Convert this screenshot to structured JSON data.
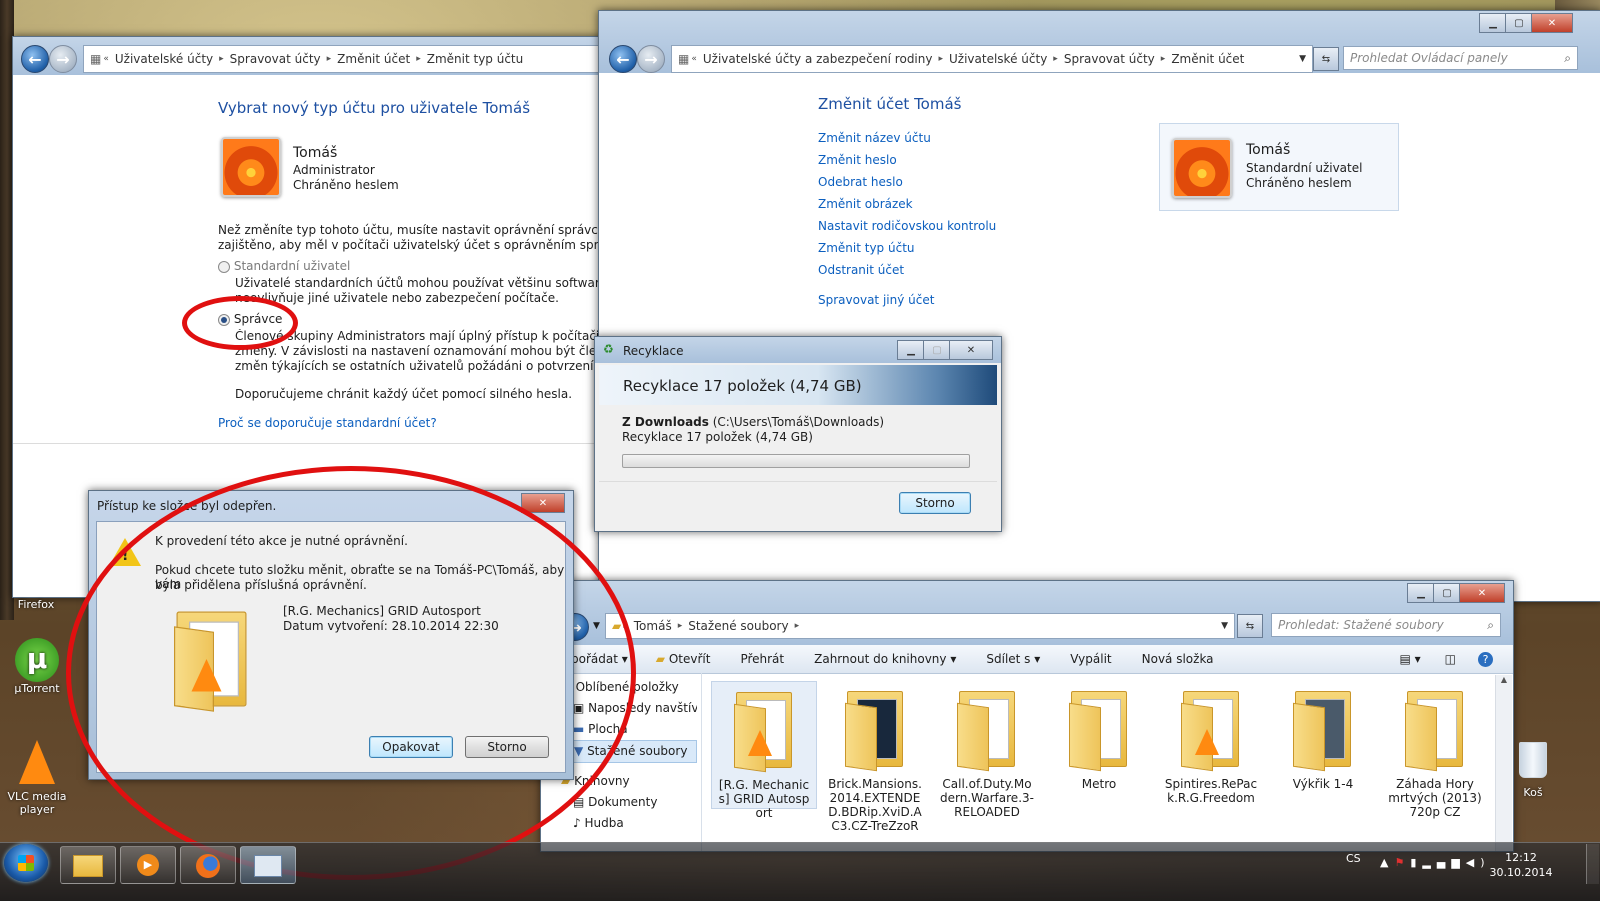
{
  "win_account_type": {
    "breadcrumb": [
      "Uživatelské účty",
      "Spravovat účty",
      "Změnit účet",
      "Změnit typ účtu"
    ],
    "heading": "Vybrat nový typ účtu pro uživatele Tomáš",
    "user_name": "Tomáš",
    "user_role": "Administrator",
    "user_status": "Chráněno heslem",
    "intro_1": "Než změníte typ tohoto účtu, musíte nastavit oprávnění správce jinému u",
    "intro_2": "zajištěno, aby měl v počítači uživatelský účet s oprávněním správce vždy n",
    "standard_label": "Standardní uživatel",
    "standard_desc_1": "Uživatelé standardních účtů mohou používat většinu softwaru a měnit",
    "standard_desc_2": "neovlivňuje jiné uživatele nebo zabezpečení počítače.",
    "admin_label": "Správce",
    "admin_desc_1": "Členové skupiny Administrators mají úplný přístup k počítači a moho",
    "admin_desc_2": "změny. V závislosti na nastavení oznamování mohou být členové skup",
    "admin_desc_3": "změn týkajících se ostatních uživatelů požádáni o potvrzení nebo zada",
    "recommend": "Doporučujeme chránit každý účet pomocí silného hesla.",
    "why_link": "Proč se doporučuje standardní účet?"
  },
  "win_change_account": {
    "breadcrumb": [
      "Uživatelské účty a zabezpečení rodiny",
      "Uživatelské účty",
      "Spravovat účty",
      "Změnit účet"
    ],
    "search_placeholder": "Prohledat Ovládací panely",
    "heading": "Změnit účet Tomáš",
    "links": [
      "Změnit název účtu",
      "Změnit heslo",
      "Odebrat heslo",
      "Změnit obrázek",
      "Nastavit rodičovskou kontrolu",
      "Změnit typ účtu",
      "Odstranit účet"
    ],
    "manage_other": "Spravovat jiný účet",
    "card_name": "Tomáš",
    "card_role": "Standardní uživatel",
    "card_status": "Chráněno heslem"
  },
  "win_recycle": {
    "title": "Recyklace",
    "header": "Recyklace 17 položek (4,74 GB)",
    "from_bold": "Z Downloads",
    "from_path": "(C:\\Users\\Tomáš\\Downloads)",
    "detail": "Recyklace 17 položek (4,74 GB)",
    "progress": 0.0,
    "cancel": "Storno"
  },
  "win_denied": {
    "title": "Přístup ke složce byl odepřen.",
    "line1": "K provedení této akce je nutné oprávnění.",
    "line2": "Pokud chcete tuto složku měnit, obraťte se na Tomáš-PC\\Tomáš, aby vám",
    "line3": "byla přidělena příslušná oprávnění.",
    "item_name": "[R.G. Mechanics] GRID Autosport",
    "item_date": "Datum vytvoření: 28.10.2014 22:30",
    "retry": "Opakovat",
    "cancel": "Storno"
  },
  "win_explorer": {
    "breadcrumb": [
      "Tomáš",
      "Stažené soubory"
    ],
    "search_placeholder": "Prohledat: Stažené soubory",
    "toolbar": [
      "pořádat",
      "Otevřít",
      "Přehrát",
      "Zahrnout do knihovny",
      "Sdílet s",
      "Vypálit",
      "Nová složka"
    ],
    "nav": [
      "Oblíbené položky",
      "Naposledy navštíver",
      "Plocha",
      "Stažené soubory",
      "Knihovny",
      "Dokumenty",
      "Hudba"
    ],
    "files": [
      "[R.G. Mechanics] GRID Autosport",
      "Brick.Mansions.2014.EXTENDED.BDRip.XviD.AC3.CZ-TreZzoR",
      "Call.of.Duty.Modern.Warfare.3-RELOADED",
      "Metro",
      "Spintires.RePack.R.G.Freedom",
      "Výkřik 1-4",
      "Záhada Hory mrtvých (2013) 720p CZ"
    ]
  },
  "desktop": {
    "icons": [
      "Firefox",
      "µTorrent",
      "VLC media player",
      "Koš"
    ]
  },
  "taskbar": {
    "lang": "CS",
    "time": "12:12",
    "date": "30.10.2014"
  },
  "colors": {
    "link": "#0c5fbf",
    "heading": "#1e50a2",
    "annotation_red": "#e01010"
  }
}
